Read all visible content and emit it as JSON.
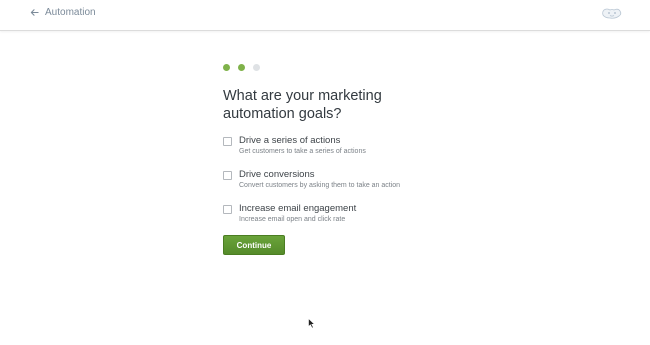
{
  "header": {
    "back_label": "Automation",
    "back_icon": "arrow-left-icon",
    "logo_icon": "mailchimp-logo-icon"
  },
  "progress": {
    "steps": [
      {
        "state": "complete"
      },
      {
        "state": "complete"
      },
      {
        "state": "incomplete"
      }
    ],
    "current_step": 2,
    "total_steps": 3
  },
  "main": {
    "title": "What are your marketing automation goals?",
    "options": [
      {
        "label": "Drive a series of actions",
        "description": "Get customers to take a series of actions",
        "checked": false
      },
      {
        "label": "Drive conversions",
        "description": "Convert customers by asking them to take an action",
        "checked": false
      },
      {
        "label": "Increase email engagement",
        "description": "Increase email open and click rate",
        "checked": false
      }
    ],
    "continue_label": "Continue"
  },
  "colors": {
    "accent_green": "#6aa33a",
    "step_complete": "#7fb24a",
    "step_incomplete": "#dfe2e5",
    "muted_text": "#7b8a99"
  }
}
